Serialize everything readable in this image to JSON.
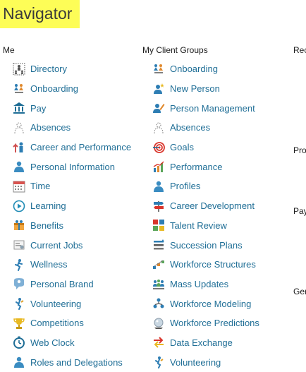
{
  "page": {
    "title": "Navigator",
    "highlight_color": "#fdfd57",
    "link_color": "#1f6e96"
  },
  "me": {
    "heading": "Me",
    "items": [
      {
        "label": "Directory",
        "icon": "directory-icon"
      },
      {
        "label": "Onboarding",
        "icon": "onboarding-icon"
      },
      {
        "label": "Pay",
        "icon": "bank-icon"
      },
      {
        "label": "Absences",
        "icon": "absences-icon"
      },
      {
        "label": "Career and Performance",
        "icon": "career-icon"
      },
      {
        "label": "Personal Information",
        "icon": "person-icon"
      },
      {
        "label": "Time",
        "icon": "calendar-icon"
      },
      {
        "label": "Learning",
        "icon": "play-icon"
      },
      {
        "label": "Benefits",
        "icon": "benefits-icon"
      },
      {
        "label": "Current Jobs",
        "icon": "current-jobs-icon"
      },
      {
        "label": "Wellness",
        "icon": "wellness-icon"
      },
      {
        "label": "Personal Brand",
        "icon": "personal-brand-icon"
      },
      {
        "label": "Volunteering",
        "icon": "volunteer-icon"
      },
      {
        "label": "Competitions",
        "icon": "trophy-icon"
      },
      {
        "label": "Web Clock",
        "icon": "clock-icon"
      },
      {
        "label": "Roles and Delegations",
        "icon": "roles-icon"
      }
    ]
  },
  "groups": {
    "heading": "My Client Groups",
    "items": [
      {
        "label": "Onboarding",
        "icon": "onboarding-icon"
      },
      {
        "label": "New Person",
        "icon": "new-person-icon"
      },
      {
        "label": "Person Management",
        "icon": "person-management-icon"
      },
      {
        "label": "Absences",
        "icon": "absences-icon"
      },
      {
        "label": "Goals",
        "icon": "target-icon"
      },
      {
        "label": "Performance",
        "icon": "performance-chart-icon"
      },
      {
        "label": "Profiles",
        "icon": "profile-icon"
      },
      {
        "label": "Career Development",
        "icon": "signpost-icon"
      },
      {
        "label": "Talent Review",
        "icon": "talent-grid-icon"
      },
      {
        "label": "Succession Plans",
        "icon": "succession-icon"
      },
      {
        "label": "Workforce Structures",
        "icon": "structure-icon"
      },
      {
        "label": "Mass Updates",
        "icon": "mass-updates-icon"
      },
      {
        "label": "Workforce Modeling",
        "icon": "modeling-icon"
      },
      {
        "label": "Workforce Predictions",
        "icon": "crystal-ball-icon"
      },
      {
        "label": "Data Exchange",
        "icon": "exchange-arrows-icon",
        "highlighted": true
      },
      {
        "label": "Volunteering",
        "icon": "volunteer-icon"
      }
    ]
  },
  "right": {
    "items": [
      "Rec",
      "Pro",
      "Pay",
      "Ger"
    ]
  }
}
